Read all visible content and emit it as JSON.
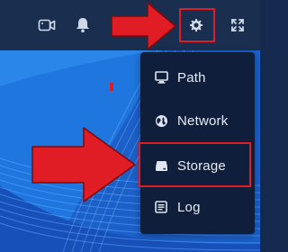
{
  "colors": {
    "topbar_bg": "#1a2f50",
    "menu_bg": "#0f1e3a",
    "menu_text": "#e6ebf4",
    "highlight": "#e01c24",
    "wallpaper_blue": "#1e7ae0"
  },
  "topbar": {
    "icons": [
      "camera-icon",
      "bell-icon",
      "gear-icon",
      "fullscreen-icon"
    ]
  },
  "menu": {
    "items": [
      {
        "label": "Path",
        "icon": "monitor-icon"
      },
      {
        "label": "Network",
        "icon": "globe-icon"
      },
      {
        "label": "Storage",
        "icon": "drive-icon"
      },
      {
        "label": "Log",
        "icon": "log-icon"
      }
    ]
  }
}
